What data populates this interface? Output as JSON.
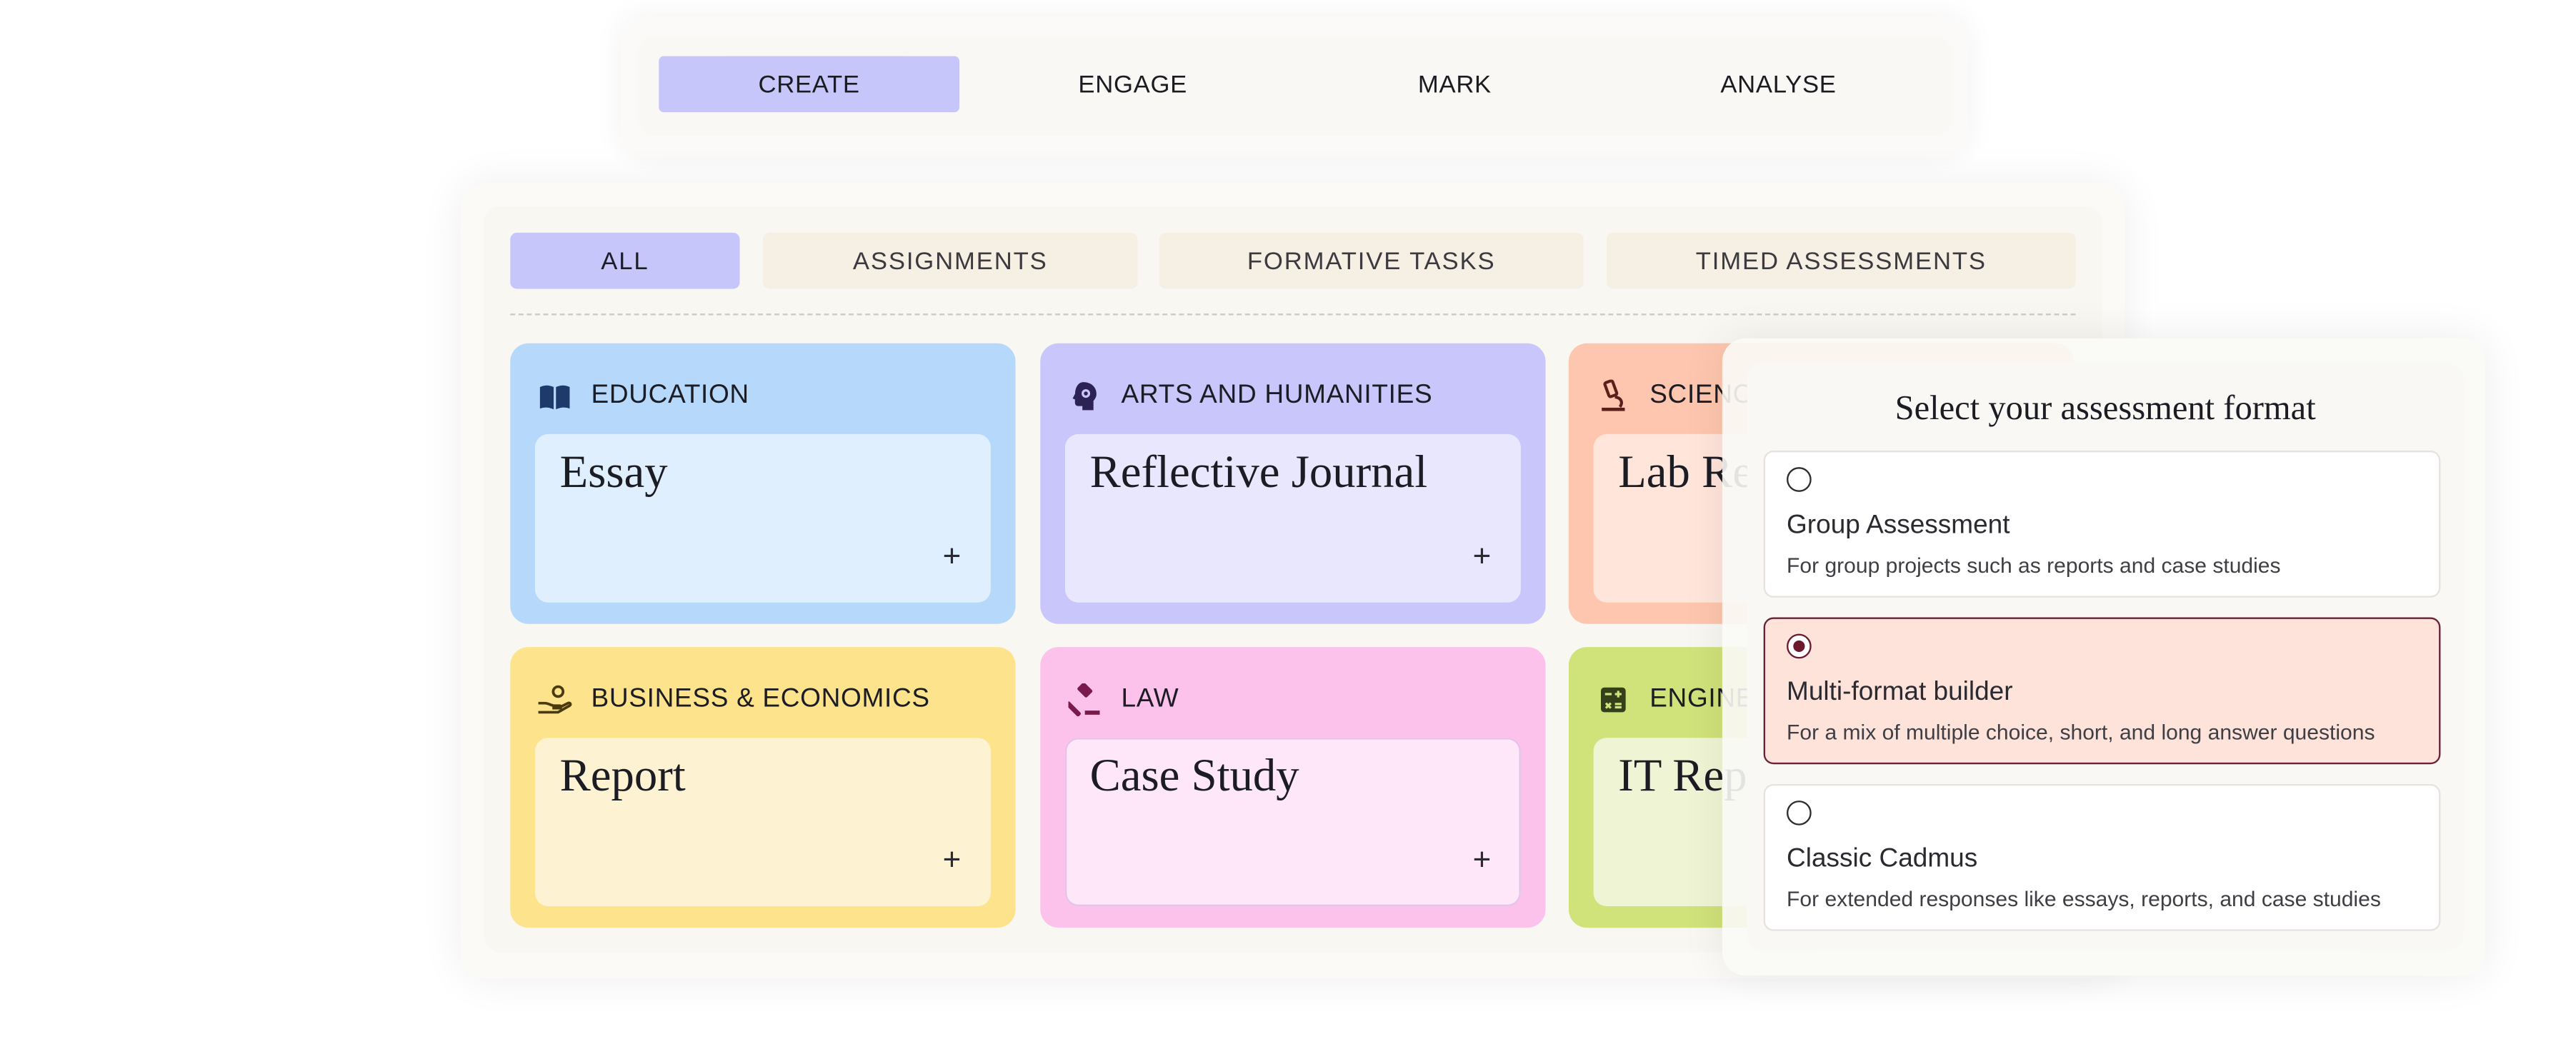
{
  "top_tabs": [
    {
      "label": "CREATE",
      "active": true
    },
    {
      "label": "ENGAGE",
      "active": false
    },
    {
      "label": "MARK",
      "active": false
    },
    {
      "label": "ANALYSE",
      "active": false
    }
  ],
  "filters": [
    {
      "label": "ALL",
      "active": true
    },
    {
      "label": "ASSIGNMENTS",
      "active": false
    },
    {
      "label": "FORMATIVE TASKS",
      "active": false
    },
    {
      "label": "TIMED ASSESSMENTS",
      "active": false
    }
  ],
  "cards": [
    {
      "category": "EDUCATION",
      "title": "Essay",
      "icon": "book-icon",
      "colors": {
        "outer": "#b6d9fb",
        "inner": "#e0effd"
      }
    },
    {
      "category": "ARTS AND HUMANITIES",
      "title": "Reflective Journal",
      "icon": "head-gear-icon",
      "colors": {
        "outer": "#c8c6fa",
        "inner": "#e8e7fd"
      }
    },
    {
      "category": "SCIENCE",
      "title": "Lab Report",
      "icon": "microscope-icon",
      "colors": {
        "outer": "#fec6ae",
        "inner": "#ffe5da"
      }
    },
    {
      "category": "BUSINESS & ECONOMICS",
      "title": "Report",
      "icon": "hand-coin-icon",
      "colors": {
        "outer": "#fde38c",
        "inner": "#fdf3d3"
      }
    },
    {
      "category": "LAW",
      "title": "Case Study",
      "icon": "gavel-icon",
      "colors": {
        "outer": "#fcc2ec",
        "inner": "#fde7f8"
      }
    },
    {
      "category": "ENGINEERING",
      "title": "IT Report",
      "icon": "calculator-icon",
      "colors": {
        "outer": "#d0e27a",
        "inner": "#eff5d4"
      }
    }
  ],
  "dialog": {
    "title": "Select your assessment format",
    "options": [
      {
        "title": "Group Assessment",
        "description": "For group projects such as reports and case studies",
        "selected": false
      },
      {
        "title": "Multi-format builder",
        "description": "For a mix of multiple choice, short, and long answer questions",
        "selected": true
      },
      {
        "title": "Classic Cadmus",
        "description": "For extended responses like essays, reports, and case studies",
        "selected": false
      }
    ]
  },
  "plus_glyph": "+"
}
